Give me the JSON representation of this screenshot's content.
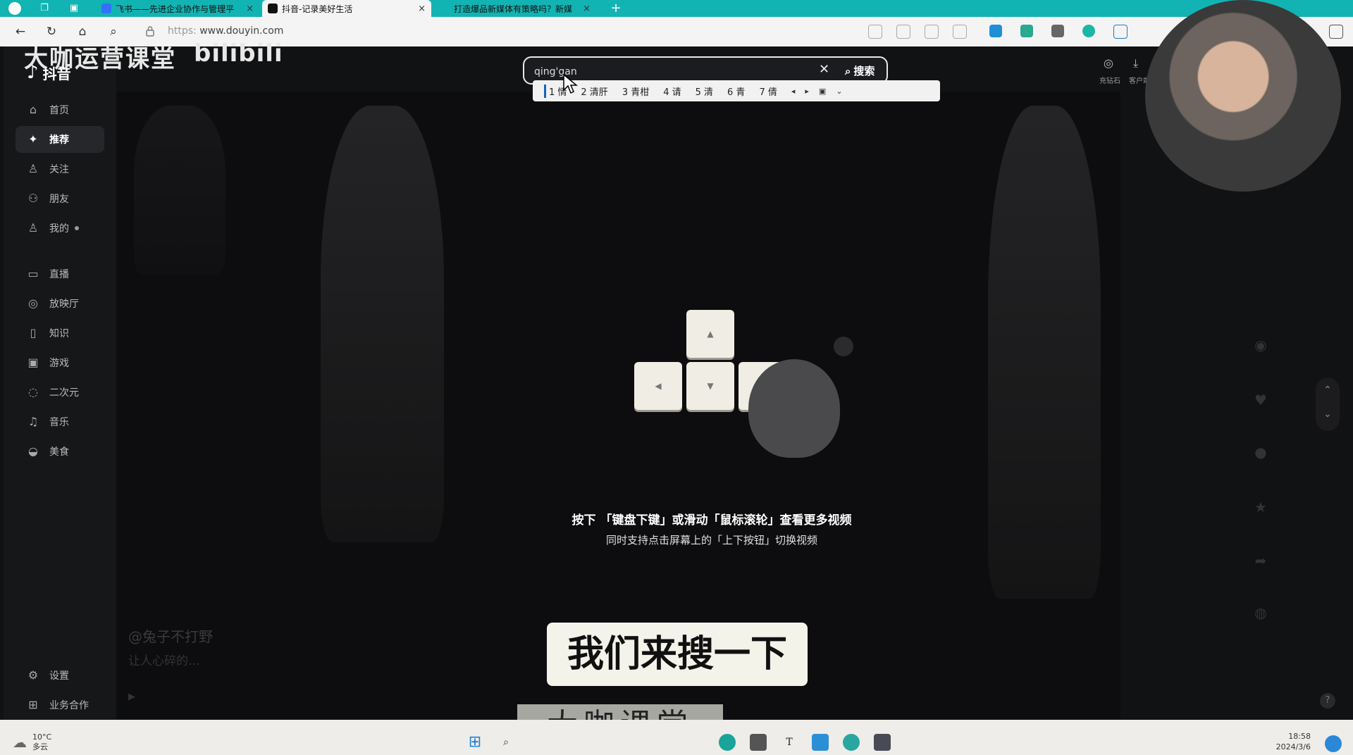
{
  "browser": {
    "tabs": [
      {
        "title": "飞书——先进企业协作与管理平",
        "close": "×",
        "favicon_color": "#3370ff"
      },
      {
        "title": "抖音-记录美好生活",
        "close": "×",
        "favicon_color": "#111111"
      },
      {
        "title": "打造爆品新媒体有策略吗？新媒",
        "close": "×",
        "favicon_color": "#e33"
      }
    ],
    "new_tab": "+",
    "url_scheme": "https:",
    "url_host": "www.douyin.com"
  },
  "watermark": {
    "top_left": "大咖运营课堂",
    "top_bili": "bilibili",
    "bottom": "大咖课堂"
  },
  "douyin": {
    "logo_text": "抖音",
    "sidebar": [
      {
        "label": "首页",
        "icon": "home-icon"
      },
      {
        "label": "推荐",
        "icon": "sparkle-icon"
      },
      {
        "label": "关注",
        "icon": "follow-icon"
      },
      {
        "label": "朋友",
        "icon": "friends-icon"
      },
      {
        "label": "我的",
        "icon": "user-icon"
      },
      {
        "label": "直播",
        "icon": "live-icon"
      },
      {
        "label": "放映厅",
        "icon": "theater-icon"
      },
      {
        "label": "知识",
        "icon": "knowledge-icon"
      },
      {
        "label": "游戏",
        "icon": "game-icon"
      },
      {
        "label": "二次元",
        "icon": "anime-icon"
      },
      {
        "label": "音乐",
        "icon": "music-icon"
      },
      {
        "label": "美食",
        "icon": "food-icon"
      }
    ],
    "sidebar_bottom": [
      {
        "label": "设置",
        "icon": "settings-icon"
      },
      {
        "label": "业务合作",
        "icon": "business-icon"
      }
    ],
    "search": {
      "value": "qing'gan",
      "button": "搜索"
    },
    "ime_candidates": [
      "1 情",
      "2 清肝",
      "3 青柑",
      "4 请",
      "5 清",
      "6 青",
      "7 倩"
    ],
    "top_right": [
      {
        "label": "充钻石"
      },
      {
        "label": "客户端"
      }
    ],
    "hint_line1": "按下 「键盘下键」或滑动「鼠标滚轮」查看更多视频",
    "hint_line2": "同时支持点击屏幕上的「上下按钮」切换视频",
    "video_author": "@兔子不打野",
    "video_desc": "让人心碎的…"
  },
  "subtitle": "我们来搜一下",
  "taskbar": {
    "temperature": "10°C",
    "weather": "多云",
    "time": "18:58",
    "date": "2024/3/6"
  }
}
